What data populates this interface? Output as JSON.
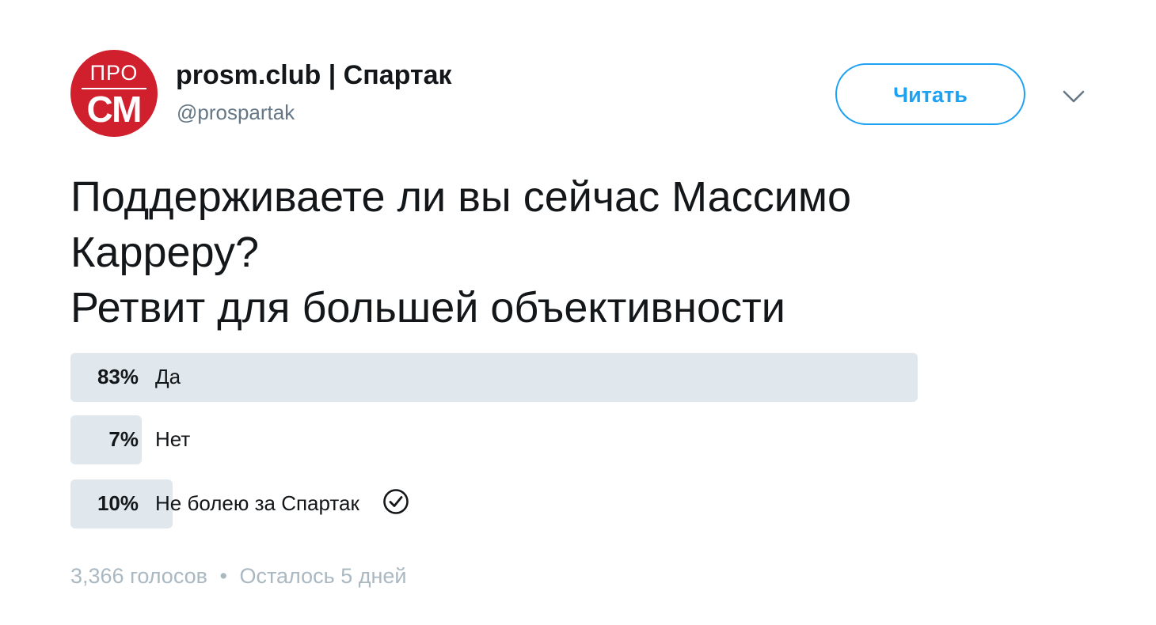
{
  "account": {
    "avatar_top": "ПРО",
    "avatar_bottom": "СМ",
    "display_name": "prosm.club | Спартак",
    "handle": "@prospartak"
  },
  "follow_button": {
    "label": "Читать"
  },
  "tweet": {
    "lines": [
      "Поддерживаете ли вы сейчас Массимо",
      "Карреру?",
      "Ретвит для большей объективности"
    ]
  },
  "poll": {
    "options": [
      {
        "percent_label": "83%",
        "percent": 83,
        "label": "Да",
        "selected": false
      },
      {
        "percent_label": "7%",
        "percent": 7,
        "label": "Нет",
        "selected": false
      },
      {
        "percent_label": "10%",
        "percent": 10,
        "label": "Не болею за Спартак",
        "selected": true
      }
    ],
    "votes": "3,366 голосов",
    "separator": "•",
    "time_left": "Осталось 5 дней"
  },
  "colors": {
    "brand_red": "#d0202e",
    "accent_blue": "#1da1f2",
    "poll_bar": "#e1e8ed",
    "muted_text": "#aab8c2"
  },
  "icons": {
    "caret": "chevron-down-icon",
    "selected": "check-circle-icon"
  }
}
